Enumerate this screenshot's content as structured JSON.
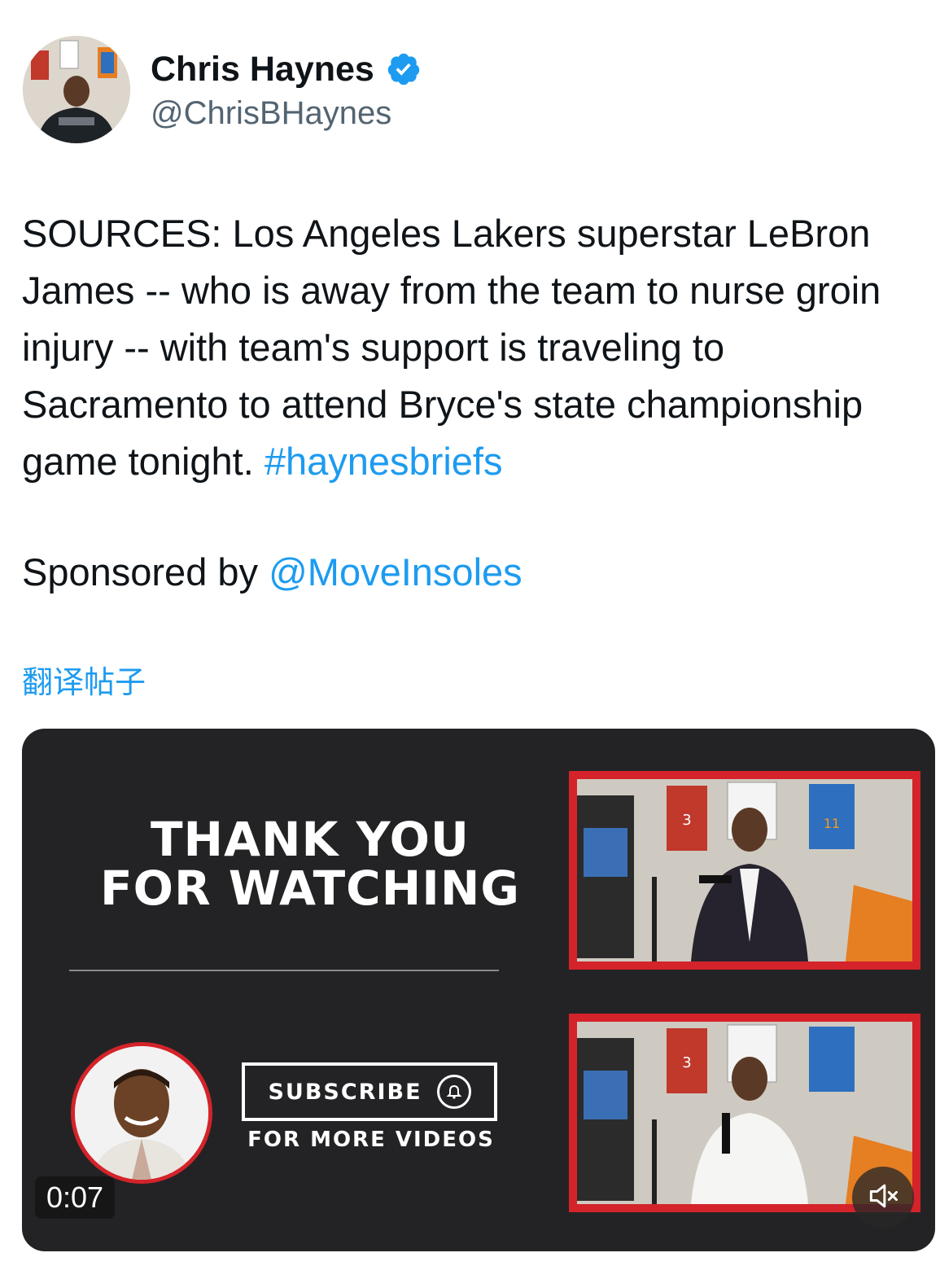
{
  "author": {
    "display_name": "Chris Haynes",
    "handle": "@ChrisBHaynes",
    "verified": true
  },
  "tweet": {
    "text_lead": "SOURCES: Los Angeles Lakers superstar LeBron James -- who is away from the team to nurse groin injury -- with team's support is traveling to Sacramento to attend Bryce's state championship game tonight. ",
    "hashtag": "#haynesbriefs",
    "sponsor_prefix": "Sponsored by ",
    "sponsor_mention": "@MoveInsoles"
  },
  "translate_label": "翻译帖子",
  "media": {
    "headline_line1": "THANK YOU",
    "headline_line2": "FOR WATCHING",
    "subscribe_label": "SUBSCRIBE",
    "more_label": "FOR MORE VIDEOS",
    "timestamp": "0:07",
    "mute_icon": "speaker-muted-icon"
  },
  "colors": {
    "link": "#1d9bf0",
    "verified": "#1d9bf0",
    "accent_red": "#d4232a",
    "media_bg": "#232325"
  }
}
